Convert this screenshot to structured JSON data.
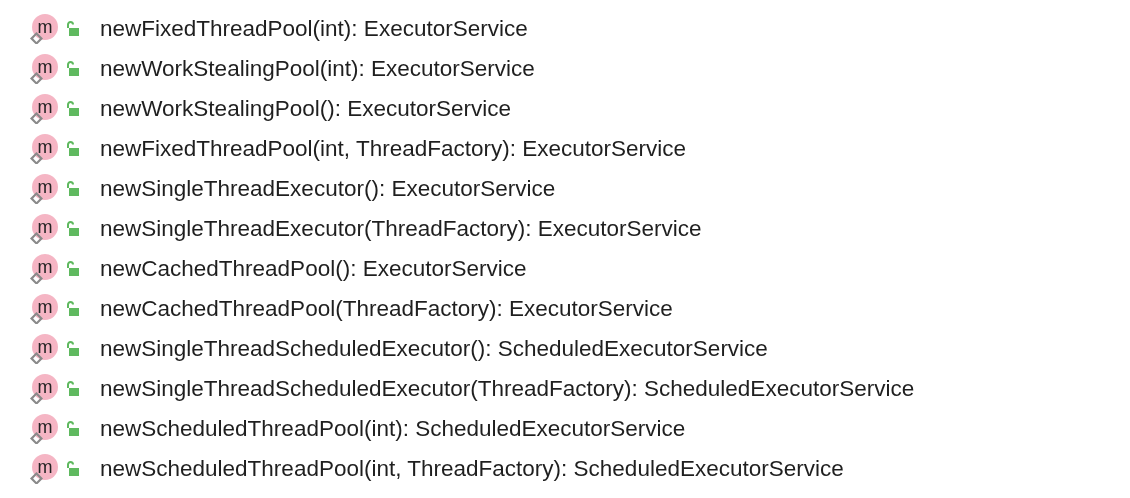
{
  "methods": [
    {
      "badge": "m",
      "signature": "newFixedThreadPool(int): ExecutorService"
    },
    {
      "badge": "m",
      "signature": "newWorkStealingPool(int): ExecutorService"
    },
    {
      "badge": "m",
      "signature": "newWorkStealingPool(): ExecutorService"
    },
    {
      "badge": "m",
      "signature": "newFixedThreadPool(int, ThreadFactory): ExecutorService"
    },
    {
      "badge": "m",
      "signature": "newSingleThreadExecutor(): ExecutorService"
    },
    {
      "badge": "m",
      "signature": "newSingleThreadExecutor(ThreadFactory): ExecutorService"
    },
    {
      "badge": "m",
      "signature": "newCachedThreadPool(): ExecutorService"
    },
    {
      "badge": "m",
      "signature": "newCachedThreadPool(ThreadFactory): ExecutorService"
    },
    {
      "badge": "m",
      "signature": "newSingleThreadScheduledExecutor(): ScheduledExecutorService"
    },
    {
      "badge": "m",
      "signature": "newSingleThreadScheduledExecutor(ThreadFactory): ScheduledExecutorService"
    },
    {
      "badge": "m",
      "signature": "newScheduledThreadPool(int): ScheduledExecutorService"
    },
    {
      "badge": "m",
      "signature": "newScheduledThreadPool(int, ThreadFactory): ScheduledExecutorService"
    }
  ]
}
